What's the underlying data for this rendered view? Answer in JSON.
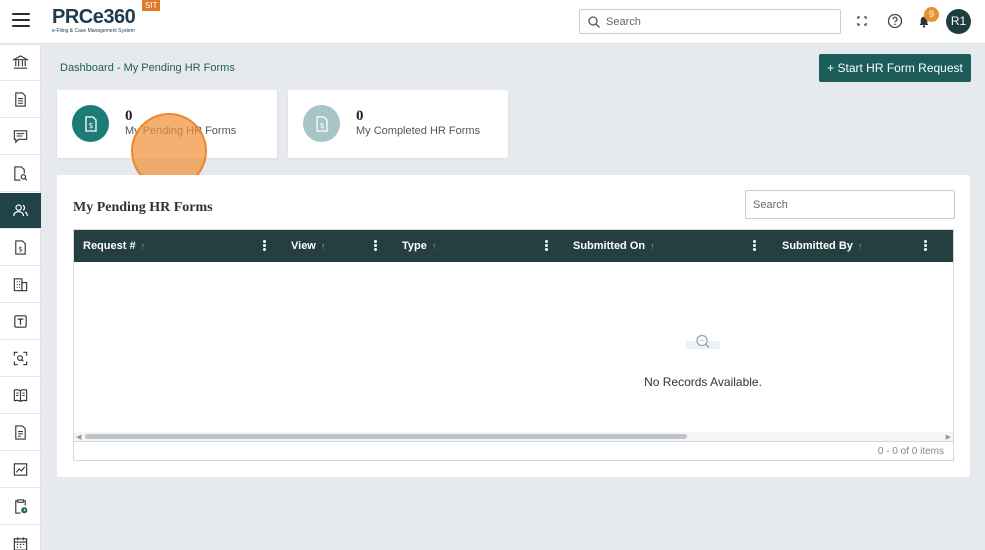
{
  "header": {
    "logo_text": "PRCe360",
    "logo_subtitle": "e-Filing & Case Management System",
    "env_badge": "SIT",
    "search_placeholder": "Search",
    "notification_count": "9",
    "user_initials": "R1"
  },
  "sidebar": {
    "items": [
      {
        "icon": "institution-icon"
      },
      {
        "icon": "document-icon"
      },
      {
        "icon": "message-icon"
      },
      {
        "icon": "document-search-icon"
      },
      {
        "icon": "users-icon",
        "active": true
      },
      {
        "icon": "dollar-document-icon"
      },
      {
        "icon": "building-icon"
      },
      {
        "icon": "text-box-icon"
      },
      {
        "icon": "scan-icon"
      },
      {
        "icon": "book-icon"
      },
      {
        "icon": "file-lines-icon"
      },
      {
        "icon": "chart-icon"
      },
      {
        "icon": "clipboard-clock-icon"
      },
      {
        "icon": "calendar-icon"
      }
    ],
    "active_color": "#1f4347"
  },
  "breadcrumb": "Dashboard - My Pending HR Forms",
  "start_button_label": "+ Start HR Form Request",
  "cards": [
    {
      "count": "0",
      "label": "My Pending HR Forms",
      "icon": "dollar-document-icon",
      "color": "#1d7c76"
    },
    {
      "count": "0",
      "label": "My Completed HR Forms",
      "icon": "dollar-document-icon",
      "color": "#a7c5c6"
    }
  ],
  "panel": {
    "title": "My Pending HR Forms",
    "search_placeholder": "Search",
    "columns": [
      "Request #",
      "View",
      "Type",
      "Submitted On",
      "Submitted By"
    ],
    "empty_message": "No Records Available.",
    "pager_text": "0 - 0 of 0 items"
  },
  "colors": {
    "primary": "#1d5d59",
    "grid_header": "#253e40",
    "accent_orange": "#e8912f"
  }
}
